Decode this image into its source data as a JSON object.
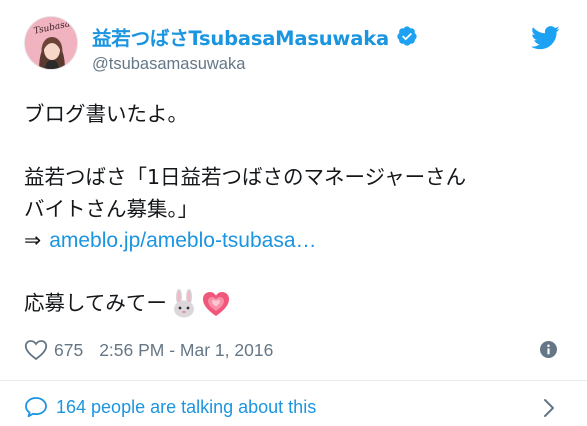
{
  "author": {
    "display_name": "益若つばさTsubasaMasuwaka",
    "handle": "@tsubasamasuwaka",
    "verified": true,
    "avatar_logo_text": "Tsubasa"
  },
  "tweet": {
    "line1": "ブログ書いたよ。",
    "line2": "益若つばさ「1日益若つばさのマネージャーさん",
    "line3": "バイトさん募集。」",
    "arrow": "⇒",
    "link_text": "ameblo.jp/ameblo-tsubasa…",
    "line5": "応募してみてー",
    "emojis": [
      "rabbit-face",
      "growing-heart"
    ]
  },
  "meta": {
    "like_count": "675",
    "timestamp": "2:56 PM - Mar 1, 2016"
  },
  "footer": {
    "talking_text": "164 people are talking about this"
  },
  "colors": {
    "accent": "#1b95e0",
    "text": "#14171a",
    "muted": "#657786",
    "divider": "#e6ecf0"
  },
  "icons": [
    "twitter-bird-icon",
    "verified-badge-icon",
    "heart-icon",
    "info-icon",
    "speech-bubble-icon",
    "chevron-right-icon"
  ]
}
